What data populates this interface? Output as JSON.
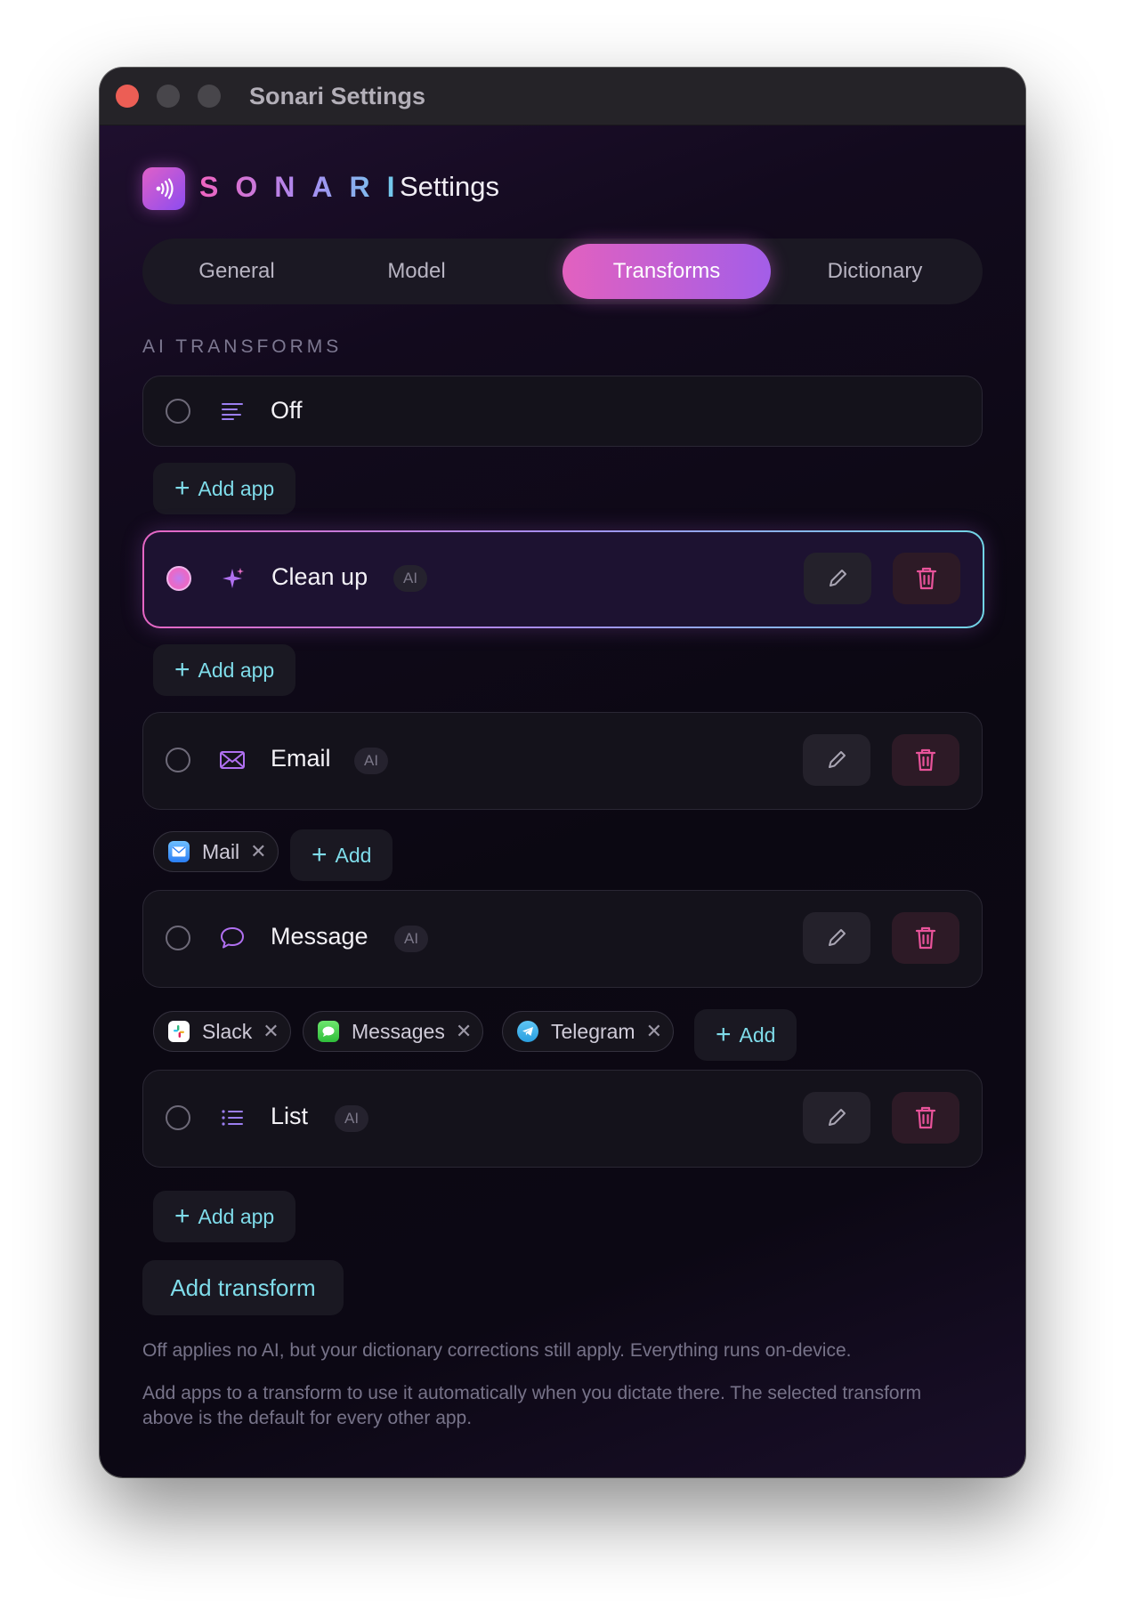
{
  "window": {
    "title": "Sonari Settings"
  },
  "header": {
    "brand": "SONARI",
    "title": "Settings"
  },
  "tabs": [
    {
      "label": "General",
      "active": false
    },
    {
      "label": "Model",
      "active": false
    },
    {
      "label": "Transforms",
      "active": true
    },
    {
      "label": "Dictionary",
      "active": false
    }
  ],
  "section": {
    "label": "AI TRANSFORMS"
  },
  "transforms": [
    {
      "name": "Off",
      "icon": "align-left-icon",
      "selected": false,
      "badge": ""
    },
    {
      "name": "Clean up",
      "icon": "sparkle-icon",
      "selected": true,
      "badge": "AI"
    },
    {
      "name": "Email",
      "icon": "envelope-icon",
      "selected": false,
      "badge": "AI",
      "apps": [
        {
          "name": "Mail",
          "icon": "mail-app-icon"
        }
      ]
    },
    {
      "name": "Message",
      "icon": "chat-bubble-icon",
      "selected": false,
      "badge": "AI",
      "apps": [
        {
          "name": "Slack",
          "icon": "slack-app-icon"
        },
        {
          "name": "Messages",
          "icon": "messages-app-icon"
        },
        {
          "name": "Telegram",
          "icon": "telegram-app-icon"
        }
      ]
    },
    {
      "name": "List",
      "icon": "list-icon",
      "selected": false,
      "badge": "AI"
    }
  ],
  "labels": {
    "add_app": "Add app",
    "add": "Add",
    "add_transform": "Add transform",
    "remove": "✕",
    "plus": "+"
  },
  "notes": [
    "Off applies no AI, but your dictionary corrections still apply. Everything runs on-device.",
    "Add apps to a transform to use it automatically when you dictate there. The selected transform above is the default for every other app."
  ],
  "colors": {
    "accent_pink": "#e261bf",
    "accent_purple": "#a35ee8",
    "accent_cyan": "#7fdcea",
    "delete": "#e8539a"
  }
}
